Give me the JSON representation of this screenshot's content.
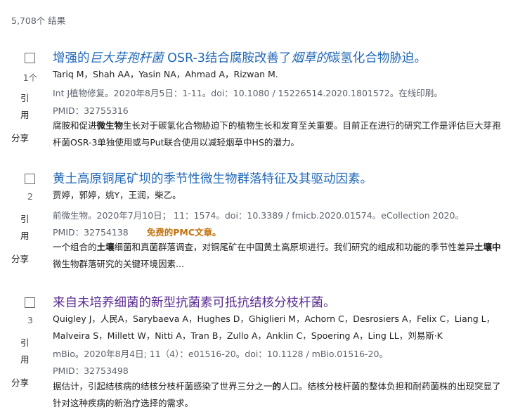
{
  "results_count": "5,708个 结果",
  "actions": {
    "cite_label": "引用",
    "share_label": "分享"
  },
  "articles": [
    {
      "number": "1个",
      "title_parts": [
        {
          "text": "增强的",
          "italic": false
        },
        {
          "text": "巨大芽孢杆菌",
          "italic": true
        },
        {
          "text": " OSR-3结合腐胺改善了",
          "italic": false
        },
        {
          "text": "烟草的",
          "italic": true
        },
        {
          "text": "碳氢化合物胁迫。",
          "italic": false
        }
      ],
      "visited": false,
      "authors": "Tariq M，Shah AA，Yasin NA，Ahmad A，Rizwan M.",
      "journal": "Int J植物修复。2020年8月5日：1-11。doi：10.1080 / 15226514.2020.1801572。在线印刷。",
      "pmid": "PMID：32755316",
      "pmc": "",
      "snippet_parts": [
        {
          "text": "腐胺和促进",
          "bold": false
        },
        {
          "text": "微生物",
          "bold": true
        },
        {
          "text": "生长对于碳氢化合物胁迫下的植物生长和发育至关重要。目前正在进行的研究工作是评估巨大芽孢杆菌OSR-3单独使用或与Put联合使用以减轻烟草中HS的潜力。",
          "bold": false
        }
      ]
    },
    {
      "number": "2",
      "title_parts": [
        {
          "text": "黄土高原铜尾矿坝的季节性微生物群落特征及其驱动因素。",
          "italic": false
        }
      ],
      "visited": false,
      "authors": "贾婷，郭婷，姚Y，王润，柴乙。",
      "journal": "前微生物。2020年7月10日； 11：1574。doi：10.3389 / fmicb.2020.01574。eCollection 2020。",
      "pmid": "PMID：32754138",
      "pmc": "免费的PMC文章。",
      "snippet_parts": [
        {
          "text": "一个组合的",
          "bold": false
        },
        {
          "text": "土壤",
          "bold": true
        },
        {
          "text": "细菌和真菌群落调查，对铜尾矿在中国黄土高原坝进行。我们研究的组成和功能的季节性差异",
          "bold": false
        },
        {
          "text": "土壤中",
          "bold": true
        },
        {
          "text": "微生物群落研究的关键环境因素...",
          "bold": false
        }
      ]
    },
    {
      "number": "3",
      "title_parts": [
        {
          "text": "来自未培养细菌的新型抗菌素可抵抗结核分枝杆菌。",
          "italic": false
        }
      ],
      "visited": true,
      "authors": "Quigley J，人民A，Sarybaeva A，Hughes D，Ghiglieri M，Achorn C，Desrosiers A，Felix C，Liang L，Malveira S，Millett W，Nitti A，Tran B，Zullo A，Anklin C，Spoering A，Ling LL，刘易斯·K",
      "journal": "mBio。2020年8月4日; 11（4）：e01516-20。doi：10.1128 / mBio.01516-20。",
      "pmid": "PMID：32753498",
      "pmc": "",
      "snippet_parts": [
        {
          "text": "据估计，引起结核病的结核分枝杆菌感染了世界三分之一",
          "bold": false
        },
        {
          "text": "的",
          "bold": true
        },
        {
          "text": "人口。结核分枝杆菌的整体负担和耐药菌株的出现突显了针对这种疾病的新治疗选择的需求。",
          "bold": false
        }
      ]
    }
  ]
}
